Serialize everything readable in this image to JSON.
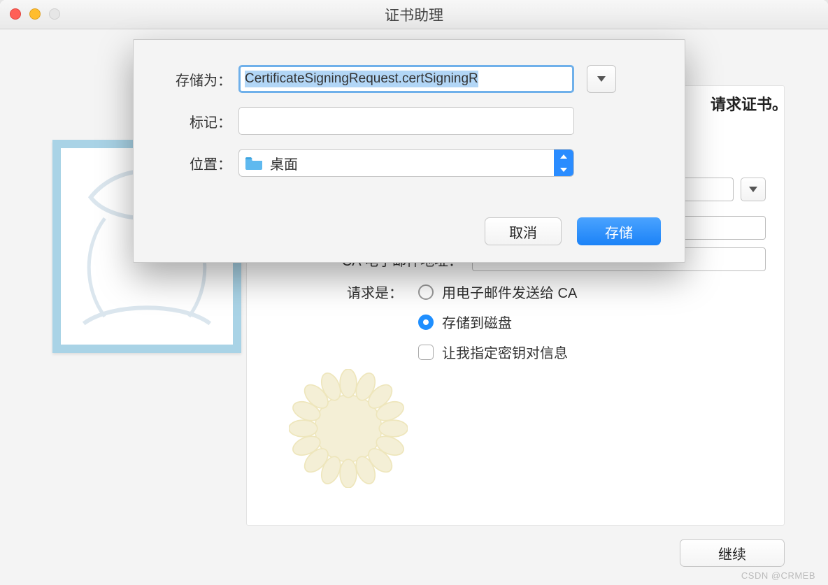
{
  "window": {
    "title": "证书助理"
  },
  "main_panel": {
    "instructions_tail": "请求证书。",
    "ca_email_label": "CA 电子邮件地址：",
    "request_label": "请求是：",
    "radio_email": "用电子邮件发送给 CA",
    "radio_disk": "存储到磁盘",
    "checkbox_keypair": "让我指定密钥对信息",
    "continue": "继续"
  },
  "save_sheet": {
    "save_as_label": "存储为：",
    "filename": "CertificateSigningRequest.certSigningR",
    "tags_label": "标记：",
    "tags_value": "",
    "location_label": "位置：",
    "location_value": "桌面",
    "cancel": "取消",
    "save": "存储"
  },
  "watermark": "CSDN @CRMEB"
}
